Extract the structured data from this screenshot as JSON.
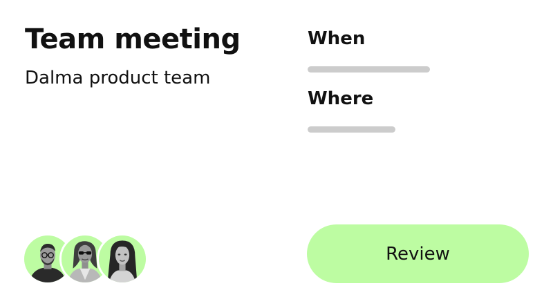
{
  "meeting": {
    "title": "Team meeting",
    "subtitle": "Dalma product team"
  },
  "details": {
    "when_label": "When",
    "where_label": "Where"
  },
  "attendees": {
    "avatars": [
      "avatar-man-glasses",
      "avatar-woman-sunglasses",
      "avatar-woman-long-hair"
    ]
  },
  "actions": {
    "review_label": "Review"
  },
  "colors": {
    "accent": "#bdfca2",
    "skeleton": "#cccccc",
    "text": "#111111",
    "background": "#ffffff"
  }
}
